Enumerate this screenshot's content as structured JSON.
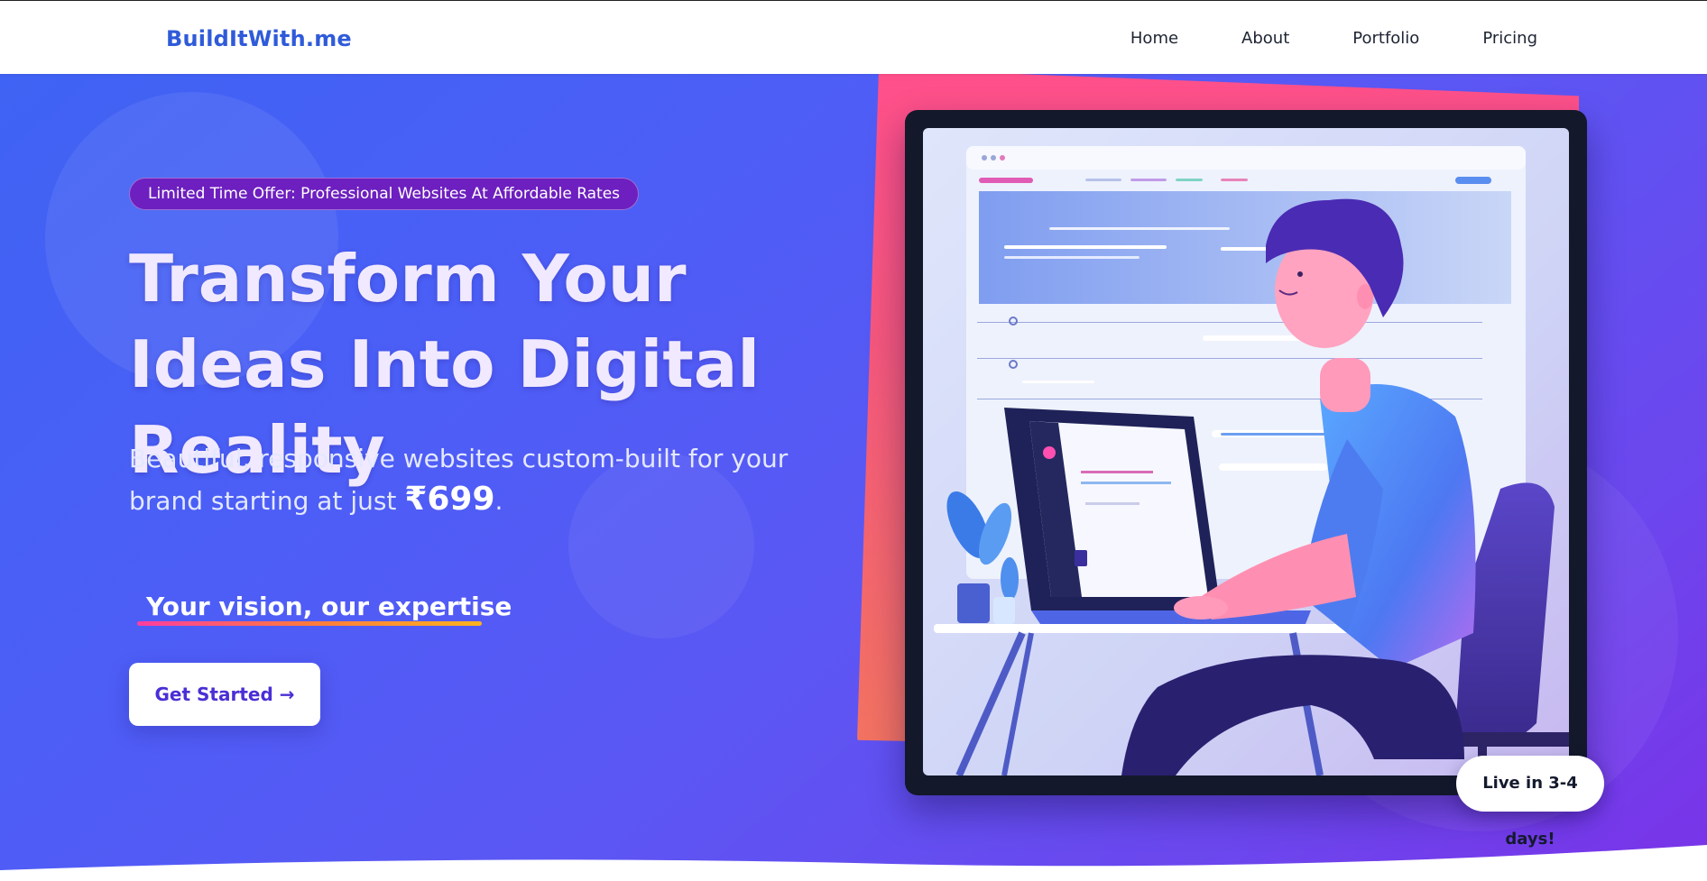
{
  "header": {
    "brand": "BuildItWith.me",
    "nav": [
      {
        "label": "Home"
      },
      {
        "label": "About"
      },
      {
        "label": "Portfolio"
      },
      {
        "label": "Pricing"
      }
    ]
  },
  "hero": {
    "badge": "Limited Time Offer: Professional Websites At Affordable Rates",
    "headline": "Transform Your Ideas Into Digital Reality",
    "subtitle_prefix": "Beautiful, responsive websites custom-built for your brand starting at just ",
    "price": "₹699",
    "subtitle_suffix": ".",
    "tagline": "Your vision, our expertise",
    "cta_label": "Get Started →",
    "live_badge": "Live in 3-4 days!"
  },
  "colors": {
    "brand": "#2f5bd9",
    "hero_start": "#3f63f4",
    "hero_end": "#7a33e8",
    "badge_bg": "#6d1fbf",
    "cta_text": "#4a2fd6",
    "accent_pink": "#ff4f8b"
  }
}
